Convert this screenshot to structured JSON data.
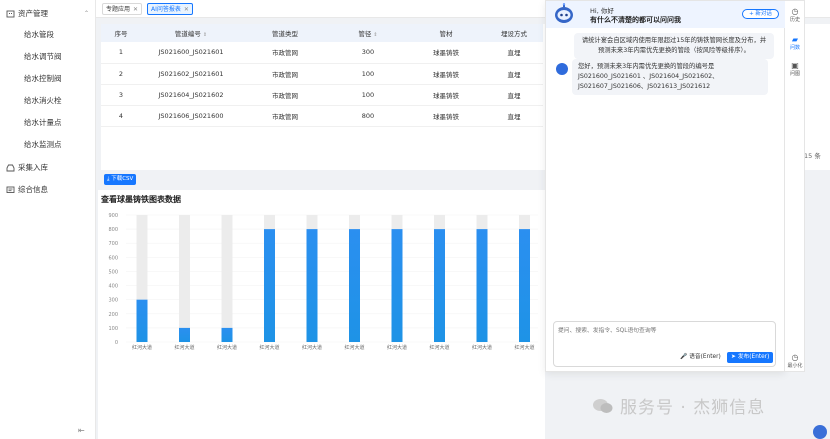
{
  "sidebar": {
    "group_asset": "资产管理",
    "items": [
      "给水管段",
      "给水调节阀",
      "给水控制阀",
      "给水消火栓",
      "给水计量点",
      "给水监测点"
    ],
    "group_collect": "采集入库",
    "group_info": "综合信息"
  },
  "tabs": [
    {
      "label": "专题应用"
    },
    {
      "label": "AI问答报表"
    }
  ],
  "table": {
    "headers": [
      "序号",
      "管道编号",
      "管道类型",
      "管径",
      "管材",
      "埋设方式"
    ],
    "rows": [
      [
        "1",
        "JS021600_JS021601",
        "市政管网",
        "300",
        "球墨铸铁",
        "直埋"
      ],
      [
        "2",
        "JS021602_JS021601",
        "市政管网",
        "100",
        "球墨铸铁",
        "直埋"
      ],
      [
        "3",
        "JS021604_JS021602",
        "市政管网",
        "100",
        "球墨铸铁",
        "直埋"
      ],
      [
        "4",
        "JS021606_JS021600",
        "市政管网",
        "800",
        "球墨铸铁",
        "直埋"
      ]
    ]
  },
  "download_csv": "下载CSV",
  "page_total": "15 条",
  "chart_title": "查看球墨铸铁图表数据",
  "chart_data": {
    "type": "bar",
    "title": "查看球墨铸铁图表数据",
    "categories": [
      "红河大道",
      "红河大道",
      "红河大道",
      "红河大道",
      "红河大道",
      "红河大道",
      "红河大道",
      "红河大道",
      "红河大道",
      "红河大道"
    ],
    "values": [
      300,
      100,
      100,
      800,
      800,
      800,
      800,
      800,
      800,
      800
    ],
    "ylim": [
      0,
      900
    ],
    "yticks": [
      0,
      100,
      200,
      300,
      400,
      500,
      600,
      700,
      800,
      900
    ],
    "colors": {
      "bar": "#1f8fe8",
      "bar_top": "#2b8ff0",
      "bar_bottom": "#1e93e6",
      "track": "#ececec"
    }
  },
  "chat": {
    "greeting": "Hi, 你好",
    "subtitle": "有什么不清楚的都可以问问我",
    "new_chat": "+ 新对话",
    "user_message": "请统计宴会自区域内使用年限超过15年的铸铁管网长度及分布，并预测未来3年内需优先更换的管段（按风险等级排序）。",
    "bot_message": "您好，预测未来3年内需优先更换的管段的编号是JS021600_JS021601 、JS021604_JS021602、JS021607_JS021606、JS021613_JS021612",
    "input_placeholder": "提问、搜索、发指令、SQL语句查询等",
    "voice_label": "语音(Enter)",
    "send_label": "发布(Enter)"
  },
  "rail": {
    "history": "历史",
    "qa": "问数",
    "image": "问图",
    "minimize": "最小化"
  },
  "watermark": "服务号 · 杰狮信息"
}
